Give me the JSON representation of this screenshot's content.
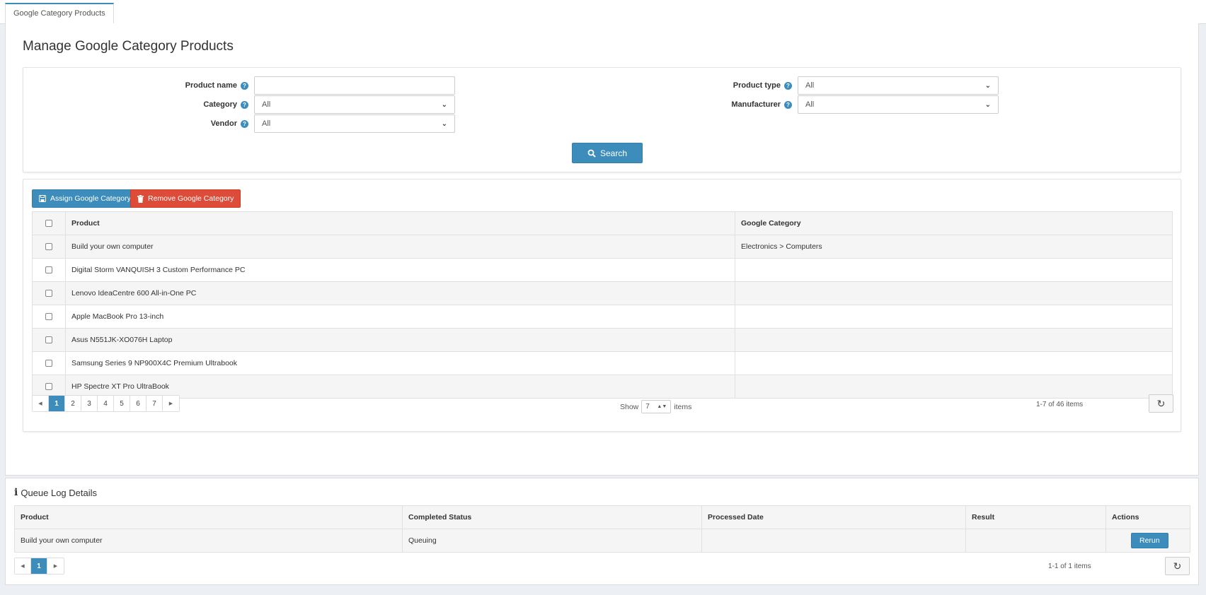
{
  "tab": {
    "label": "Google Category Products"
  },
  "page": {
    "title": "Manage Google Category Products"
  },
  "search": {
    "product_name_label": "Product name",
    "product_name_value": "",
    "category_label": "Category",
    "category_value": "All",
    "vendor_label": "Vendor",
    "vendor_value": "All",
    "product_type_label": "Product type",
    "product_type_value": "All",
    "manufacturer_label": "Manufacturer",
    "manufacturer_value": "All",
    "search_button": "Search"
  },
  "toolbar": {
    "assign_label": "Assign Google Category",
    "remove_label": "Remove Google Category"
  },
  "grid": {
    "columns": [
      "Product",
      "Google Category"
    ],
    "rows": [
      {
        "product": "Build your own computer",
        "google_category": "Electronics > Computers"
      },
      {
        "product": "Digital Storm VANQUISH 3 Custom Performance PC",
        "google_category": ""
      },
      {
        "product": "Lenovo IdeaCentre 600 All-in-One PC",
        "google_category": ""
      },
      {
        "product": "Apple MacBook Pro 13-inch",
        "google_category": ""
      },
      {
        "product": "Asus N551JK-XO076H Laptop",
        "google_category": ""
      },
      {
        "product": "Samsung Series 9 NP900X4C Premium Ultrabook",
        "google_category": ""
      },
      {
        "product": "HP Spectre XT Pro UltraBook",
        "google_category": ""
      }
    ],
    "pager": {
      "pages": [
        "1",
        "2",
        "3",
        "4",
        "5",
        "6",
        "7"
      ],
      "current": "1"
    },
    "show_label": "Show",
    "page_size": "7",
    "items_label": "items",
    "count_text": "1-7 of 46 items"
  },
  "queue_log": {
    "title": "Queue Log Details",
    "columns": [
      "Product",
      "Completed Status",
      "Processed Date",
      "Result",
      "Actions"
    ],
    "rows": [
      {
        "product": "Build your own computer",
        "status": "Queuing",
        "date": "",
        "result": "",
        "action": "Rerun"
      }
    ],
    "pager": {
      "pages": [
        "1"
      ],
      "current": "1"
    },
    "count_text": "1-1 of 1 items"
  },
  "icons": {
    "help": "question-circle-icon",
    "search": "search-icon",
    "save": "save-icon",
    "trash": "trash-icon",
    "refresh": "refresh-icon",
    "info": "info-icon"
  },
  "colors": {
    "primary": "#3c8dbc",
    "danger": "#dd4b39",
    "background": "#ecf0f5"
  }
}
